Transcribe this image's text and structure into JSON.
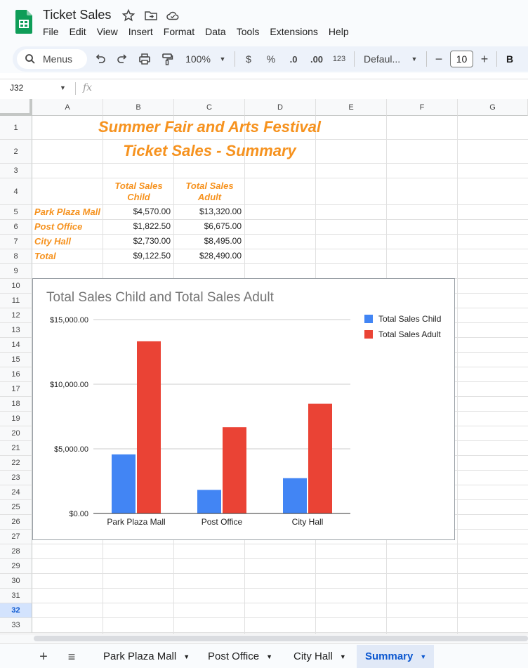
{
  "app": {
    "doc_title": "Ticket Sales",
    "menus": [
      "File",
      "Edit",
      "View",
      "Insert",
      "Format",
      "Data",
      "Tools",
      "Extensions",
      "Help"
    ]
  },
  "toolbar": {
    "search_label": "Menus",
    "zoom": "100%",
    "currency": "$",
    "percent": "%",
    "decrease_decimals": ".0",
    "increase_decimals": ".00",
    "more_formats": "123",
    "font": "Defaul...",
    "minus": "−",
    "font_size": "10",
    "plus": "+",
    "bold": "B"
  },
  "formula_bar": {
    "name_box": "J32",
    "fx": "fx"
  },
  "columns": [
    "A",
    "B",
    "C",
    "D",
    "E",
    "F",
    "G"
  ],
  "rows": [
    "1",
    "2",
    "3",
    "4",
    "5",
    "6",
    "7",
    "8",
    "9",
    "10",
    "11",
    "12",
    "13",
    "14",
    "15",
    "16",
    "17",
    "18",
    "19",
    "20",
    "21",
    "22",
    "23",
    "24",
    "25",
    "26",
    "27",
    "28",
    "29",
    "30",
    "31",
    "32",
    "33"
  ],
  "active_row": "32",
  "sheet": {
    "title1": "Summer Fair and Arts Festival",
    "title2": "Ticket Sales - Summary",
    "header_child": "Total Sales Child",
    "header_adult": "Total Sales Adult",
    "rows": [
      {
        "label": "Park Plaza Mall",
        "child": "$4,570.00",
        "adult": "$13,320.00"
      },
      {
        "label": "Post Office",
        "child": "$1,822.50",
        "adult": "$6,675.00"
      },
      {
        "label": "City Hall",
        "child": "$2,730.00",
        "adult": "$8,495.00"
      },
      {
        "label": "Total",
        "child": "$9,122.50",
        "adult": "$28,490.00"
      }
    ]
  },
  "chart_data": {
    "type": "bar",
    "title": "Total Sales Child and Total Sales Adult",
    "categories": [
      "Park Plaza Mall",
      "Post Office",
      "City Hall"
    ],
    "series": [
      {
        "name": "Total Sales Child",
        "values": [
          4570,
          1822.5,
          2730
        ],
        "color": "#4285f4"
      },
      {
        "name": "Total Sales Adult",
        "values": [
          13320,
          6675,
          8495
        ],
        "color": "#ea4335"
      }
    ],
    "ylim": [
      0,
      15000
    ],
    "yticks": [
      "$0.00",
      "$5,000.00",
      "$10,000.00",
      "$15,000.00"
    ],
    "ytick_values": [
      0,
      5000,
      10000,
      15000
    ],
    "legend_position": "right",
    "grid": true
  },
  "tabs": [
    {
      "label": "Park Plaza Mall",
      "active": false
    },
    {
      "label": "Post Office",
      "active": false
    },
    {
      "label": "City Hall",
      "active": false
    },
    {
      "label": "Summary",
      "active": true
    }
  ],
  "tab_controls": {
    "add": "+",
    "all_sheets": "≡"
  }
}
